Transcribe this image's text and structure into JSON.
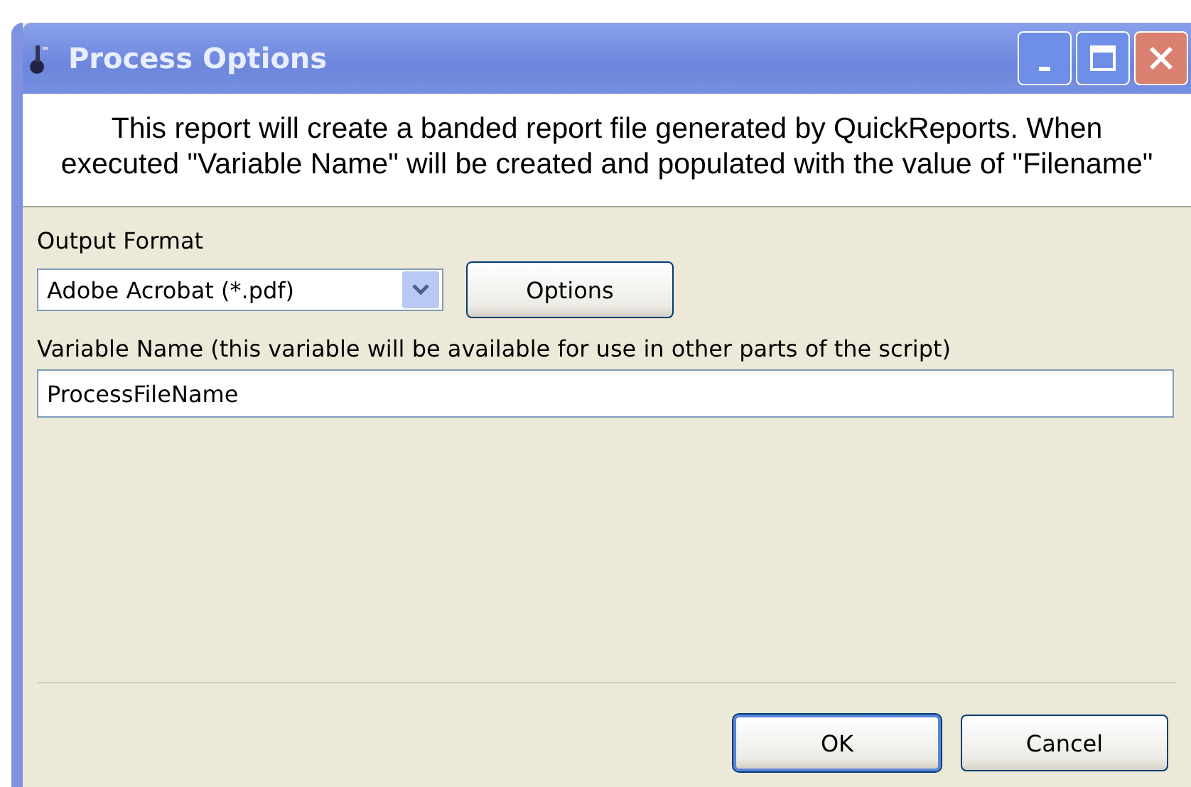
{
  "window": {
    "title": "Process Options"
  },
  "description": "This report will create a banded report file generated by QuickReports.  When\nexecuted \"Variable Name\" will be created and populated with the value of \"Filename\"",
  "output_format": {
    "label": "Output Format",
    "value": "Adobe Acrobat (*.pdf)",
    "options_button": "Options"
  },
  "variable_name": {
    "label": "Variable Name (this variable will be available for use in other parts of the script)",
    "value": "ProcessFileName"
  },
  "buttons": [
    {
      "label": "OK",
      "default": true
    },
    {
      "label": "Cancel",
      "default": false
    }
  ]
}
